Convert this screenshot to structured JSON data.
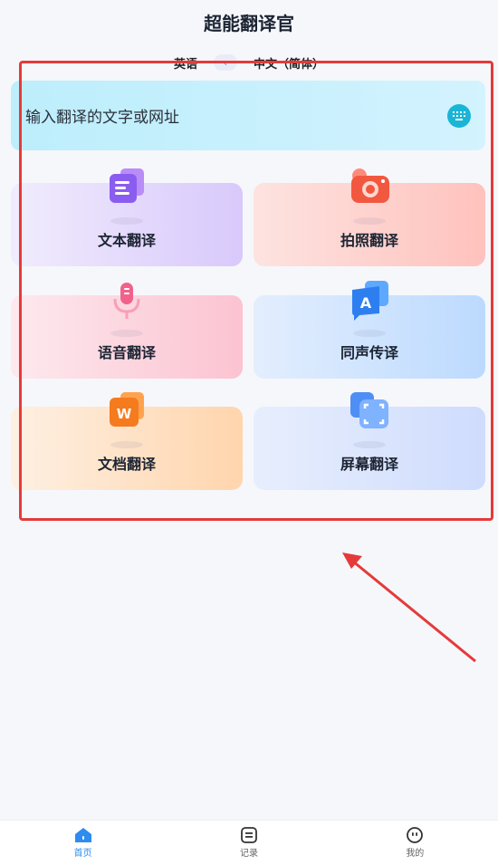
{
  "header": {
    "title": "超能翻译官"
  },
  "language_bar": {
    "source": "英语",
    "target": "中文（简体）"
  },
  "input": {
    "placeholder": "输入翻译的文字或网址"
  },
  "features": [
    {
      "label": "文本翻译",
      "icon": "text-document-icon"
    },
    {
      "label": "拍照翻译",
      "icon": "camera-icon"
    },
    {
      "label": "语音翻译",
      "icon": "microphone-icon"
    },
    {
      "label": "同声传译",
      "icon": "speech-bubble-a-icon"
    },
    {
      "label": "文档翻译",
      "icon": "word-document-icon"
    },
    {
      "label": "屏幕翻译",
      "icon": "screen-scan-icon"
    }
  ],
  "tabbar": {
    "items": [
      {
        "label": "首页",
        "icon": "home-icon",
        "active": true
      },
      {
        "label": "记录",
        "icon": "record-list-icon",
        "active": false
      },
      {
        "label": "我的",
        "icon": "profile-face-icon",
        "active": false
      }
    ]
  },
  "colors": {
    "accent": "#2e8bf0",
    "annotation": "#e53a3a"
  }
}
